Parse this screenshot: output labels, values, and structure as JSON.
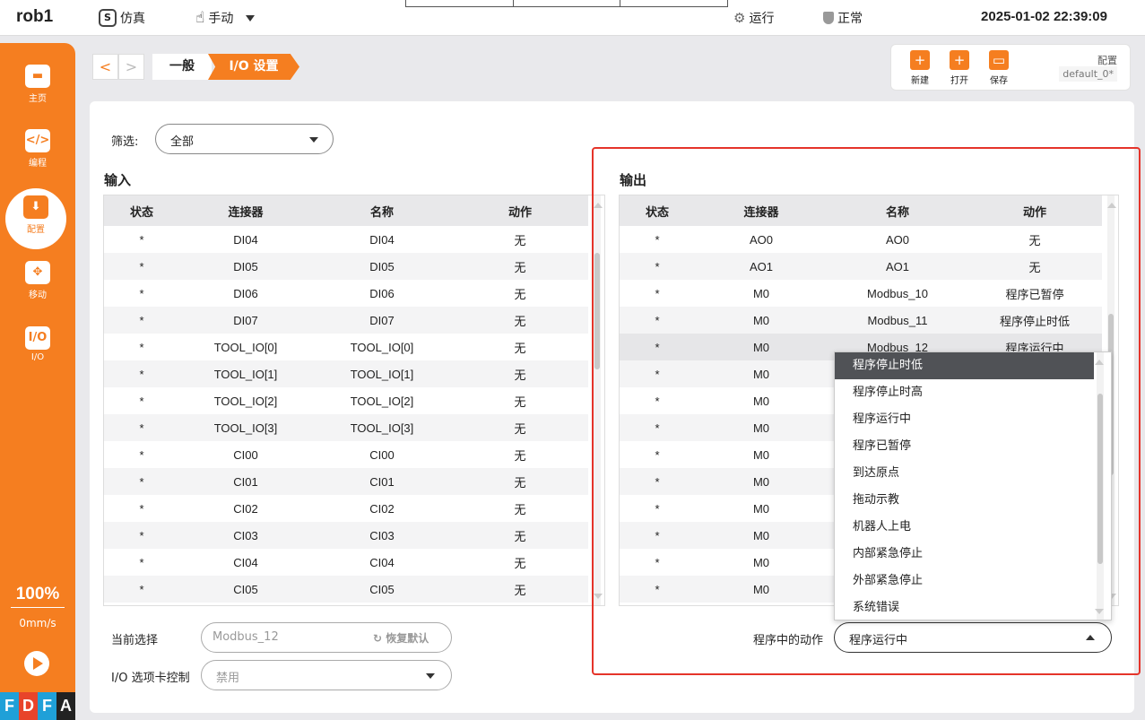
{
  "topbar": {
    "robot_name": "rob1",
    "mode_sim": "仿真",
    "mode_manual": "手动",
    "run_status": "运行",
    "health_status": "正常",
    "datetime": "2025-01-02 22:39:09"
  },
  "sidebar": {
    "items": [
      {
        "label": "主页",
        "icon": "home-icon"
      },
      {
        "label": "编程",
        "icon": "code-icon"
      },
      {
        "label": "配置",
        "icon": "config-icon"
      },
      {
        "label": "移动",
        "icon": "move-icon"
      },
      {
        "label": "I/O",
        "icon": "io-icon"
      }
    ],
    "speed_pct": "100%",
    "speed_val": "0mm/s",
    "brand": [
      "F",
      "D",
      "F",
      "A"
    ],
    "brand_colors": [
      "#1fa0d8",
      "#e8442a",
      "#1fa0d8",
      "#222222"
    ]
  },
  "breadcrumb": {
    "general": "一般",
    "io": "I/O 设置"
  },
  "toolbar": {
    "new_label": "新建",
    "open_label": "打开",
    "save_label": "保存",
    "config_label": "配置",
    "config_name": "default_0*"
  },
  "filter": {
    "label": "筛选:",
    "value": "全部"
  },
  "input": {
    "title": "输入",
    "headers": [
      "状态",
      "连接器",
      "名称",
      "动作"
    ],
    "rows": [
      [
        "*",
        "DI04",
        "DI04",
        "无"
      ],
      [
        "*",
        "DI05",
        "DI05",
        "无"
      ],
      [
        "*",
        "DI06",
        "DI06",
        "无"
      ],
      [
        "*",
        "DI07",
        "DI07",
        "无"
      ],
      [
        "*",
        "TOOL_IO[0]",
        "TOOL_IO[0]",
        "无"
      ],
      [
        "*",
        "TOOL_IO[1]",
        "TOOL_IO[1]",
        "无"
      ],
      [
        "*",
        "TOOL_IO[2]",
        "TOOL_IO[2]",
        "无"
      ],
      [
        "*",
        "TOOL_IO[3]",
        "TOOL_IO[3]",
        "无"
      ],
      [
        "*",
        "CI00",
        "CI00",
        "无"
      ],
      [
        "*",
        "CI01",
        "CI01",
        "无"
      ],
      [
        "*",
        "CI02",
        "CI02",
        "无"
      ],
      [
        "*",
        "CI03",
        "CI03",
        "无"
      ],
      [
        "*",
        "CI04",
        "CI04",
        "无"
      ],
      [
        "*",
        "CI05",
        "CI05",
        "无"
      ]
    ]
  },
  "output": {
    "title": "输出",
    "headers": [
      "状态",
      "连接器",
      "名称",
      "动作"
    ],
    "rows": [
      [
        "*",
        "AO0",
        "AO0",
        "无"
      ],
      [
        "*",
        "AO1",
        "AO1",
        "无"
      ],
      [
        "*",
        "M0",
        "Modbus_10",
        "程序已暂停"
      ],
      [
        "*",
        "M0",
        "Modbus_11",
        "程序停止时低"
      ],
      [
        "*",
        "M0",
        "Modbus_12",
        "程序运行中"
      ],
      [
        "*",
        "M0",
        "",
        ""
      ],
      [
        "*",
        "M0",
        "",
        ""
      ],
      [
        "*",
        "M0",
        "",
        ""
      ],
      [
        "*",
        "M0",
        "",
        ""
      ],
      [
        "*",
        "M0",
        "",
        ""
      ],
      [
        "*",
        "M0",
        "",
        ""
      ],
      [
        "*",
        "M0",
        "",
        ""
      ],
      [
        "*",
        "M0",
        "",
        ""
      ],
      [
        "*",
        "M0",
        "",
        ""
      ]
    ]
  },
  "controls": {
    "current_label": "当前选择",
    "current_placeholder": "Modbus_12",
    "restore_label": "恢复默认",
    "io_card_label": "I/O 选项卡控制",
    "io_card_value": "禁用",
    "action_label": "程序中的动作",
    "action_value": "程序运行中"
  },
  "dropdown": {
    "options": [
      "程序停止时低",
      "程序停止时高",
      "程序运行中",
      "程序已暂停",
      "到达原点",
      "拖动示教",
      "机器人上电",
      "内部紧急停止",
      "外部紧急停止",
      "系统错误"
    ],
    "highlighted": "程序停止时低"
  },
  "colors": {
    "accent": "#f57e20",
    "highlight_border": "#e5342a",
    "dropdown_active": "#505256"
  }
}
